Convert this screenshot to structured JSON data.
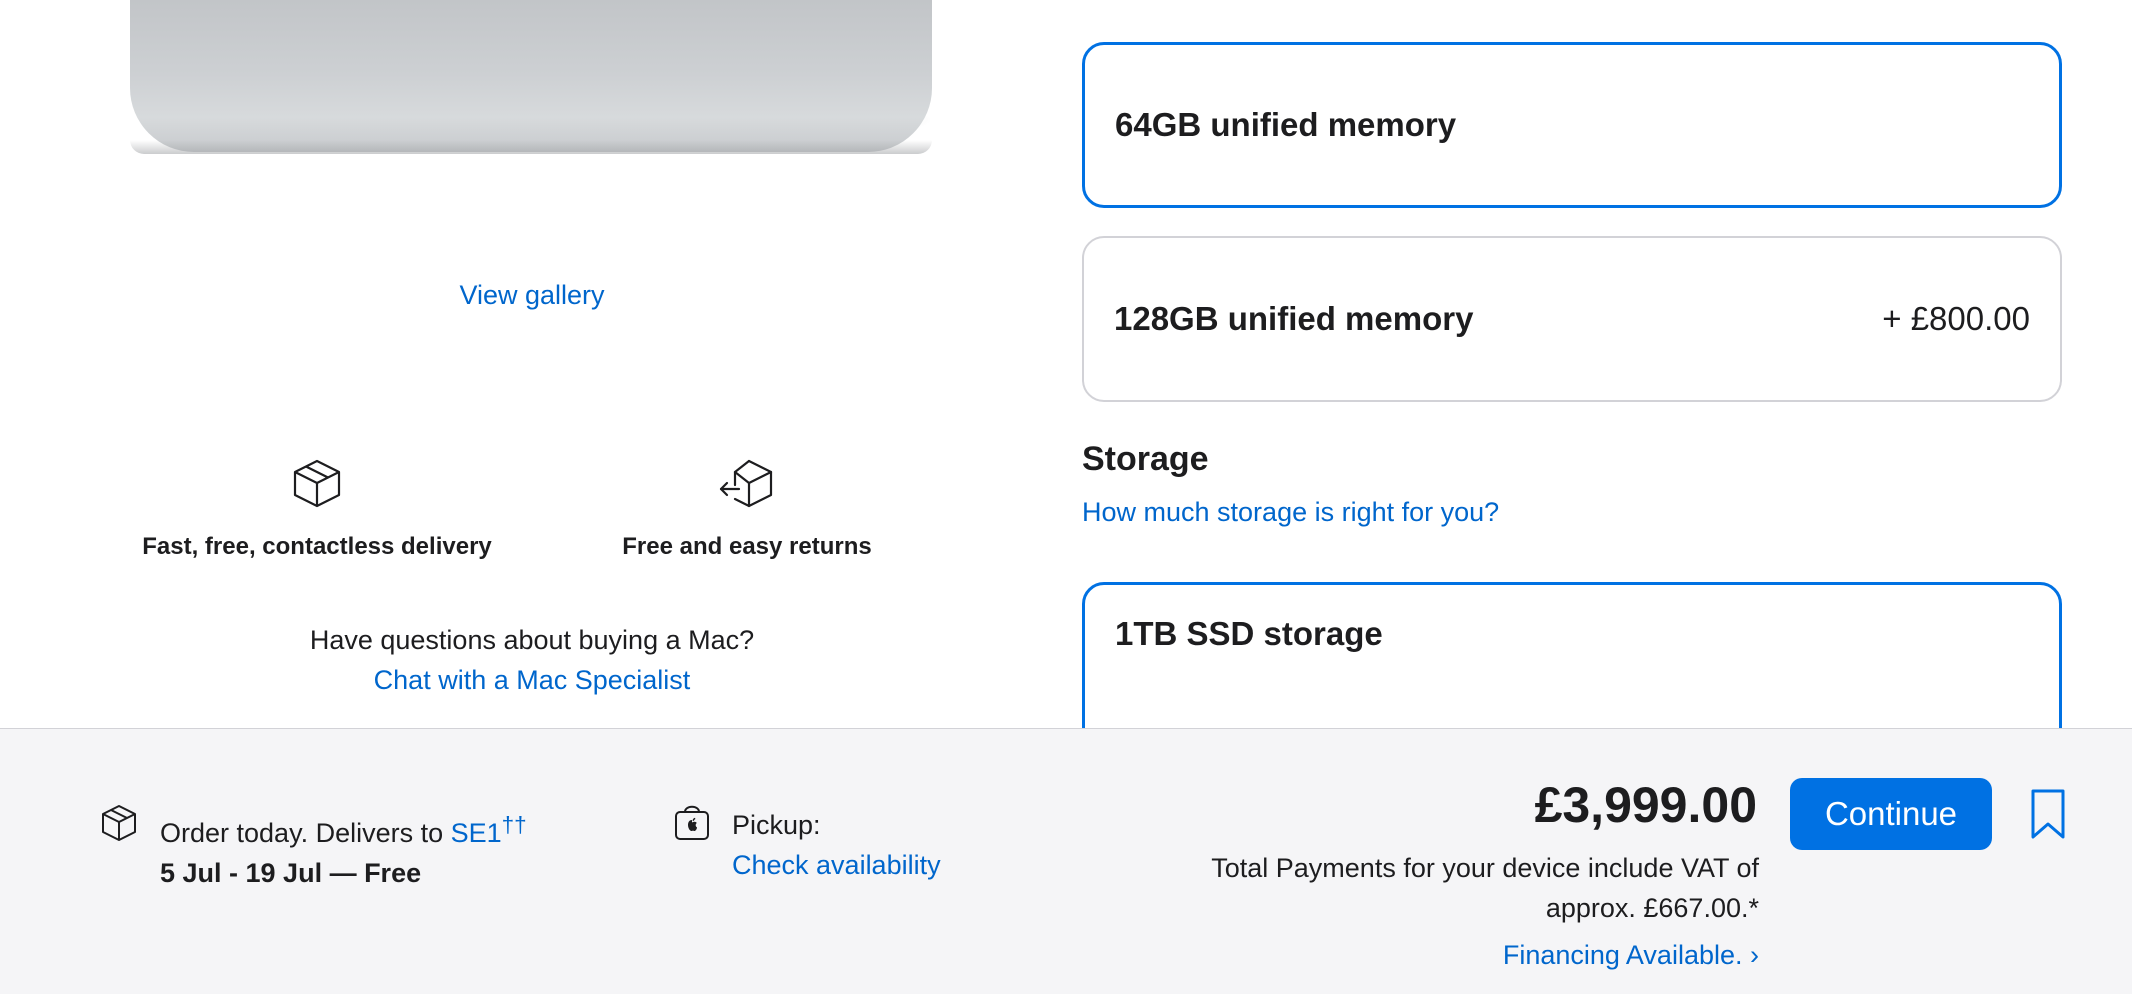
{
  "gallery": {
    "view_gallery": "View gallery"
  },
  "perks": [
    {
      "icon": "box-icon",
      "label": "Fast, free, contactless delivery"
    },
    {
      "icon": "box-return-icon",
      "label": "Free and easy returns"
    }
  ],
  "questions": {
    "text": "Have questions about buying a Mac?",
    "link": "Chat with a Mac Specialist"
  },
  "memory_options": [
    {
      "label": "64GB unified memory",
      "price": "",
      "selected": true
    },
    {
      "label": "128GB unified memory",
      "price": "+ £800.00",
      "selected": false
    }
  ],
  "storage": {
    "heading": "Storage",
    "help_link": "How much storage is right for you?",
    "options": [
      {
        "label": "1TB SSD storage",
        "selected": true
      }
    ]
  },
  "bottom_bar": {
    "delivery_prefix": "Order today. Delivers to ",
    "delivery_postcode": "SE1",
    "delivery_sup": "††",
    "delivery_dates": "5 Jul - 19 Jul — Free",
    "pickup_label": "Pickup:",
    "pickup_link": "Check availability",
    "price": "£3,999.00",
    "vat_note": "Total Payments for your device include VAT of approx. £667.00.*",
    "financing": "Financing Available. ›",
    "continue_label": "Continue"
  },
  "colors": {
    "accent": "#0071e3",
    "link": "#0066cc",
    "text": "#1d1d1f",
    "bar_bg": "#f5f5f7"
  }
}
